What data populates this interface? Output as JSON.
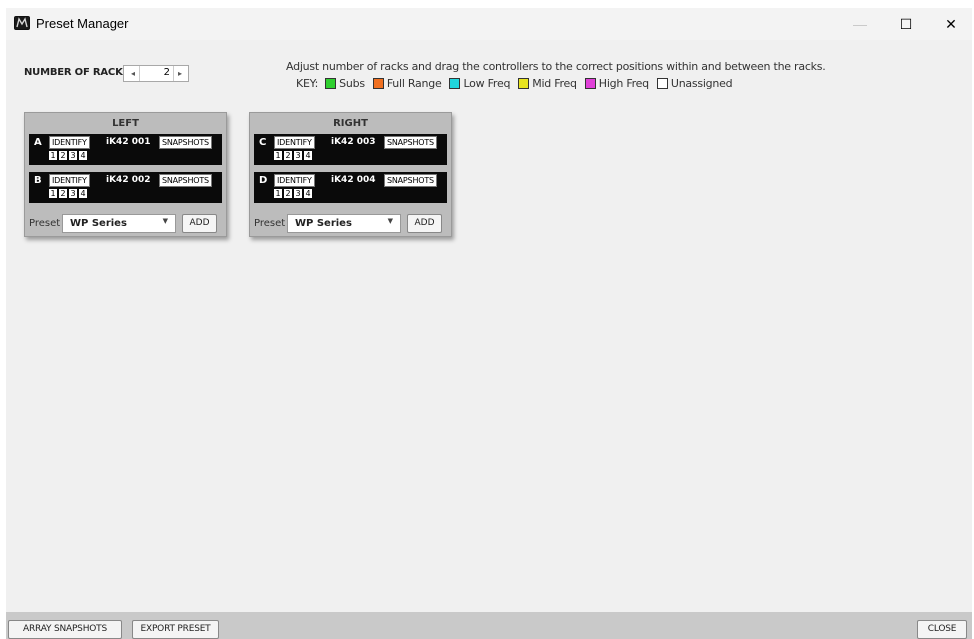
{
  "window": {
    "title": "Preset Manager",
    "controls": {
      "minimize": "—",
      "maximize": "☐",
      "close": "✕"
    }
  },
  "racks_control": {
    "label": "NUMBER OF RACKS",
    "value": "2",
    "dec_glyph": "◂",
    "inc_glyph": "▸"
  },
  "instructions": "Adjust number of racks and drag the controllers to the correct positions within and between the racks.",
  "key": {
    "label": "KEY:",
    "items": [
      {
        "label": "Subs",
        "color": "#2fcf2f"
      },
      {
        "label": "Full Range",
        "color": "#f07020"
      },
      {
        "label": "Low Freq",
        "color": "#20d6dc"
      },
      {
        "label": "Mid Freq",
        "color": "#e8e420"
      },
      {
        "label": "High Freq",
        "color": "#e040d8"
      },
      {
        "label": "Unassigned",
        "color": "#ffffff"
      }
    ]
  },
  "racks": [
    {
      "title": "LEFT",
      "slots": [
        {
          "letter": "A",
          "identify": "IDENTIFY",
          "name": "iK42 001",
          "snapshots": "SNAPSHOTS",
          "snap_numbers": [
            "1",
            "2",
            "3",
            "4"
          ]
        },
        {
          "letter": "B",
          "identify": "IDENTIFY",
          "name": "iK42 002",
          "snapshots": "SNAPSHOTS",
          "snap_numbers": [
            "1",
            "2",
            "3",
            "4"
          ]
        }
      ],
      "preset_label": "Preset",
      "preset_value": "WP Series",
      "add_label": "ADD"
    },
    {
      "title": "RIGHT",
      "slots": [
        {
          "letter": "C",
          "identify": "IDENTIFY",
          "name": "iK42 003",
          "snapshots": "SNAPSHOTS",
          "snap_numbers": [
            "1",
            "2",
            "3",
            "4"
          ]
        },
        {
          "letter": "D",
          "identify": "IDENTIFY",
          "name": "iK42 004",
          "snapshots": "SNAPSHOTS",
          "snap_numbers": [
            "1",
            "2",
            "3",
            "4"
          ]
        }
      ],
      "preset_label": "Preset",
      "preset_value": "WP Series",
      "add_label": "ADD"
    }
  ],
  "footer": {
    "array_snapshots": "ARRAY SNAPSHOTS",
    "export_preset": "EXPORT PRESET",
    "close": "CLOSE"
  }
}
